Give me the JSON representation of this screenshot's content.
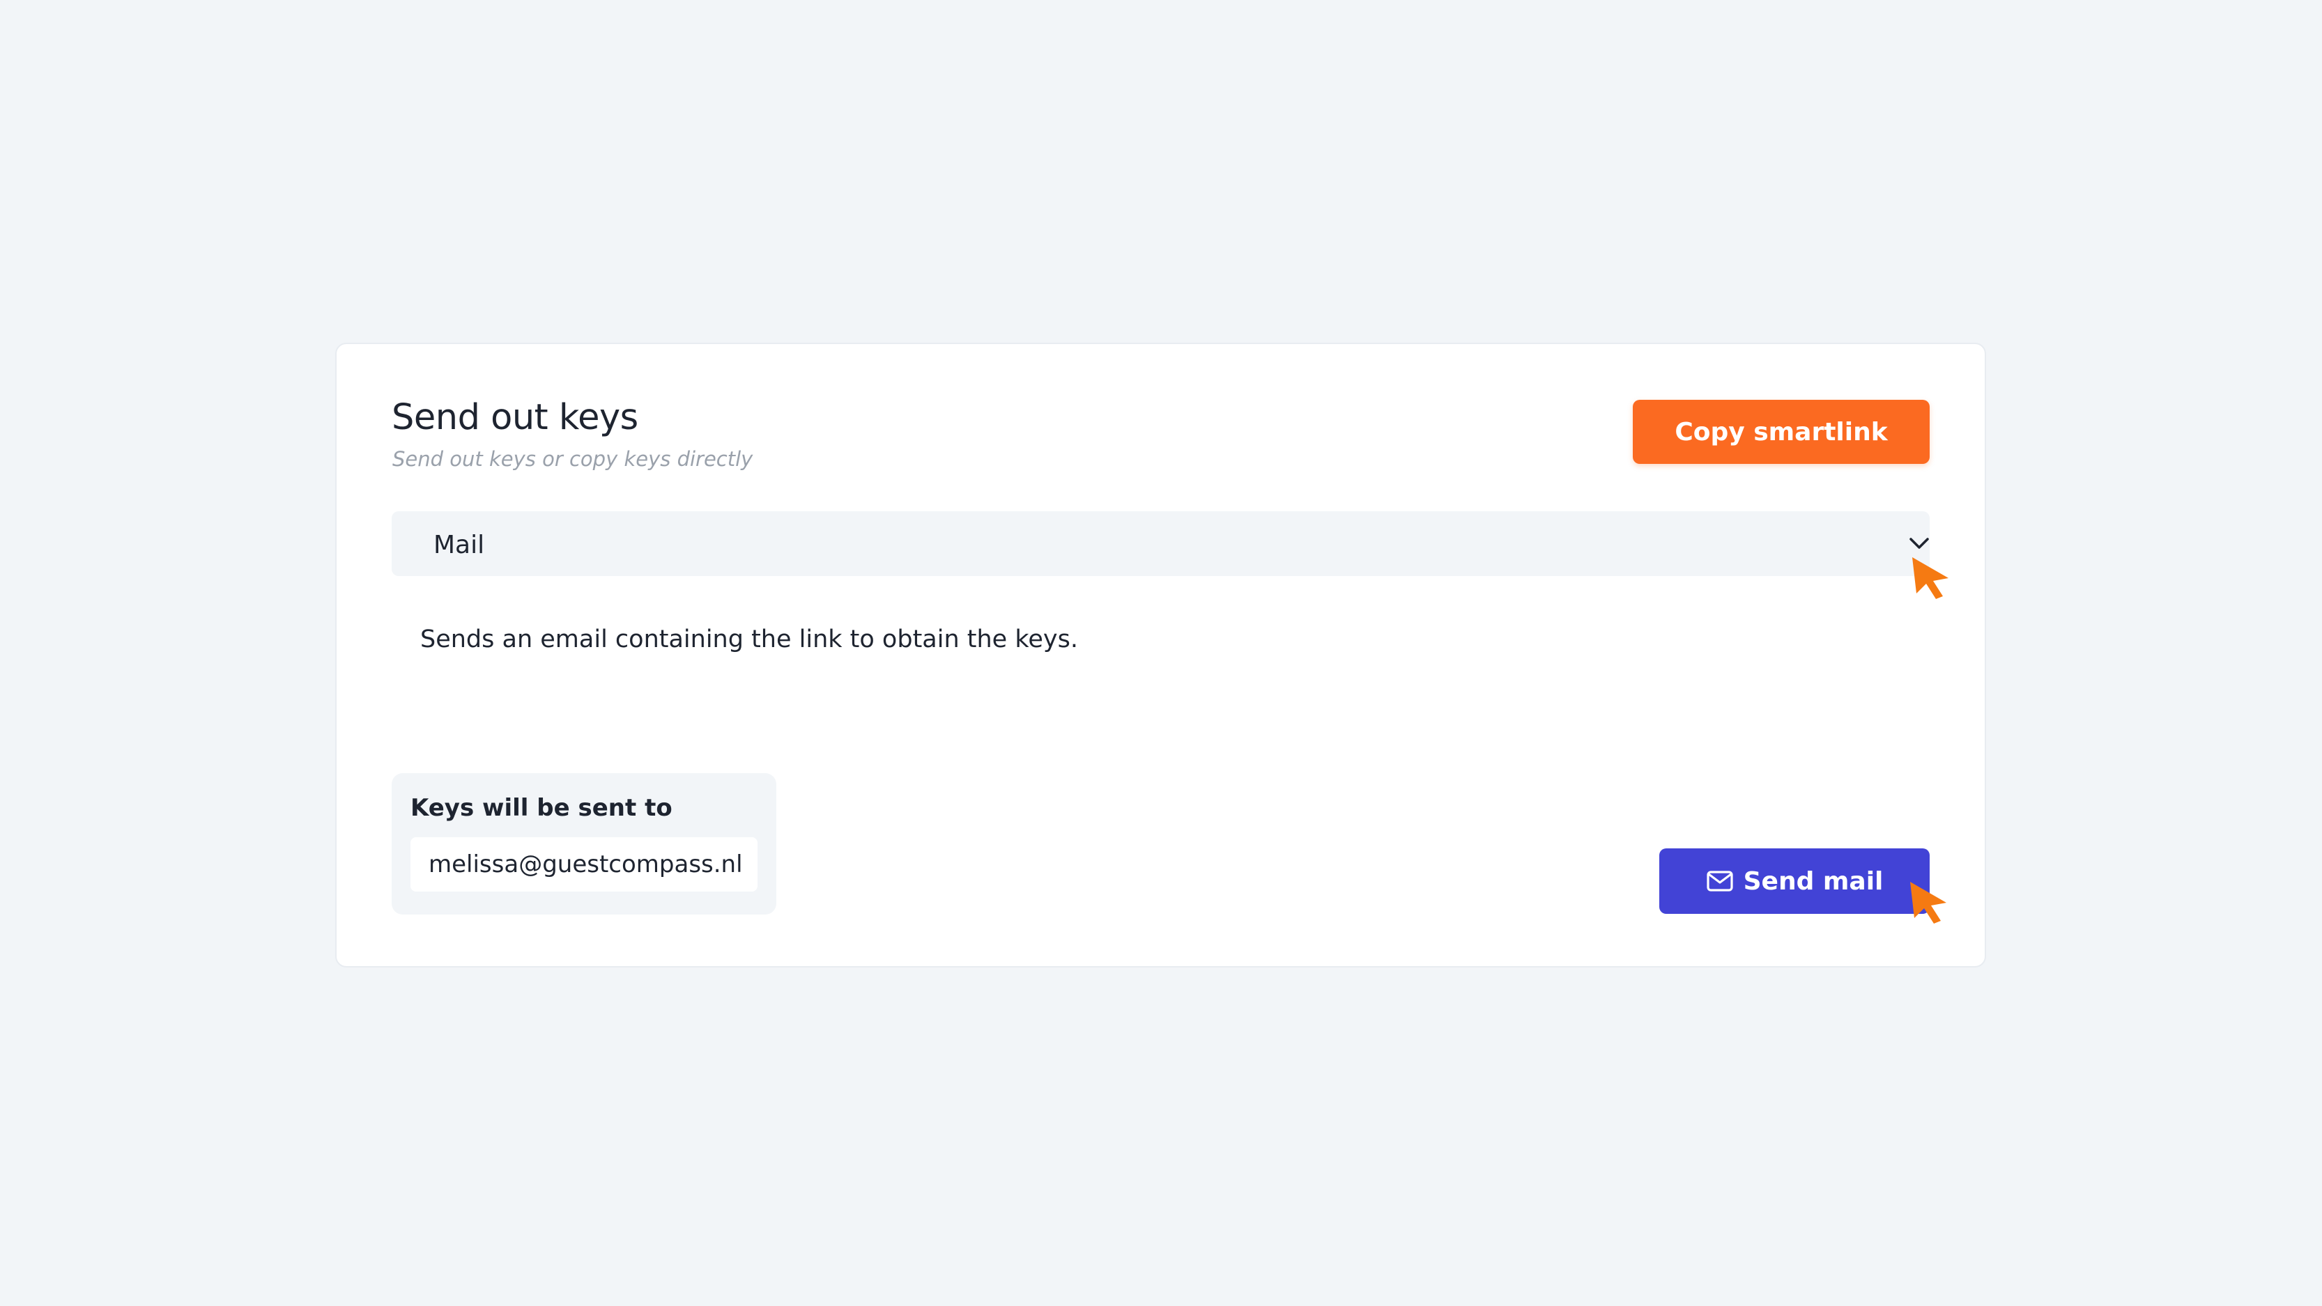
{
  "card": {
    "title": "Send out keys",
    "subtitle": "Send out keys or copy keys directly",
    "copy_button_label": "Copy smartlink",
    "method_select": {
      "selected": "Mail",
      "icon": "chevron-down-icon"
    },
    "description": "Sends an email containing the link to obtain the keys.",
    "recipient": {
      "label": "Keys will be sent to",
      "email": "melissa@guestcompass.nl"
    },
    "send_button": {
      "label": "Send mail",
      "icon": "mail-icon"
    }
  },
  "colors": {
    "background": "#f2f5f8",
    "card": "#ffffff",
    "accent_orange": "#fb6a21",
    "accent_indigo": "#4243d6",
    "text": "#1e2430",
    "muted_text": "#9aa1ab",
    "cursor": "#f57a12"
  }
}
